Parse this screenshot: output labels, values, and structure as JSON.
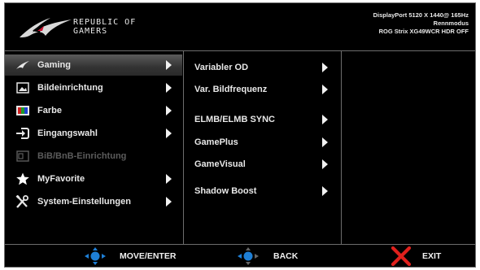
{
  "brand": {
    "line1": "REPUBLIC OF",
    "line2": "GAMERS"
  },
  "status": {
    "line1": "DisplayPort 5120 X 1440@ 165Hz",
    "line2": "Rennmodus",
    "line3": "ROG Strix XG49WCR HDR OFF"
  },
  "menu": [
    {
      "label": "Gaming",
      "icon": "rog-eye-icon",
      "selected": true,
      "enabled": true
    },
    {
      "label": "Bildeinrichtung",
      "icon": "picture-icon",
      "selected": false,
      "enabled": true
    },
    {
      "label": "Farbe",
      "icon": "color-icon",
      "selected": false,
      "enabled": true
    },
    {
      "label": "Eingangswahl",
      "icon": "input-icon",
      "selected": false,
      "enabled": true
    },
    {
      "label": "BiB/BnB-Einrichtung",
      "icon": "pip-icon",
      "selected": false,
      "enabled": false
    },
    {
      "label": "MyFavorite",
      "icon": "star-icon",
      "selected": false,
      "enabled": true
    },
    {
      "label": "System-Einstellungen",
      "icon": "wrench-screwdriver-icon",
      "selected": false,
      "enabled": true
    }
  ],
  "submenu": [
    {
      "label": "Variabler OD"
    },
    {
      "label": "Var. Bildfrequenz"
    },
    {
      "label": "ELMB/ELMB SYNC"
    },
    {
      "label": "GamePlus"
    },
    {
      "label": "GameVisual"
    },
    {
      "label": "Shadow Boost"
    }
  ],
  "footer": {
    "move": {
      "label": "MOVE/ENTER",
      "icon": "four-way-joystick-icon"
    },
    "back": {
      "label": "BACK",
      "icon": "back-joystick-icon"
    },
    "exit": {
      "label": "EXIT",
      "icon": "exit-x-icon"
    }
  },
  "colors": {
    "accent_blue": "#1e7fd6",
    "exit_red": "#e0201c",
    "panel_bg": "#000000",
    "border": "#6d6d6d"
  }
}
